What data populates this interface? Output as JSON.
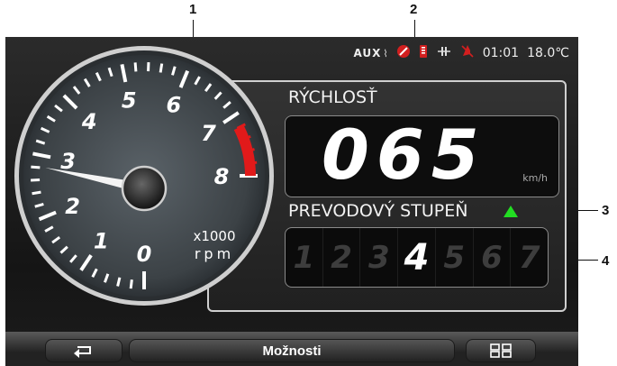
{
  "callouts": [
    "1",
    "2",
    "3",
    "4"
  ],
  "status": {
    "aux": "AUX",
    "time": "01:01",
    "temperature": "18.0℃",
    "icons": [
      "aux-plug-icon",
      "no-signal-icon",
      "phone-battery-icon",
      "network-icon",
      "mute-icon"
    ]
  },
  "tachometer": {
    "numbers": [
      "0",
      "1",
      "2",
      "3",
      "4",
      "5",
      "6",
      "7",
      "8"
    ],
    "multiplier": "x1000",
    "unit": "rpm",
    "needle_value": 3,
    "redline_from": 7.2
  },
  "speed": {
    "label": "RÝCHLOSŤ",
    "value": "065",
    "unit": "km/h"
  },
  "gear": {
    "label": "PREVODOVÝ STUPEŇ",
    "indicator": "up-arrow",
    "numbers": [
      "1",
      "2",
      "3",
      "4",
      "5",
      "6",
      "7"
    ],
    "active": "4"
  },
  "bottom": {
    "back_icon": "back-arrow-icon",
    "options_label": "Možnosti",
    "menu_icon": "grid-menu-icon"
  },
  "colors": {
    "redline": "#e11a1a",
    "up_arrow": "#22dd22",
    "status_red": "#e22222"
  }
}
